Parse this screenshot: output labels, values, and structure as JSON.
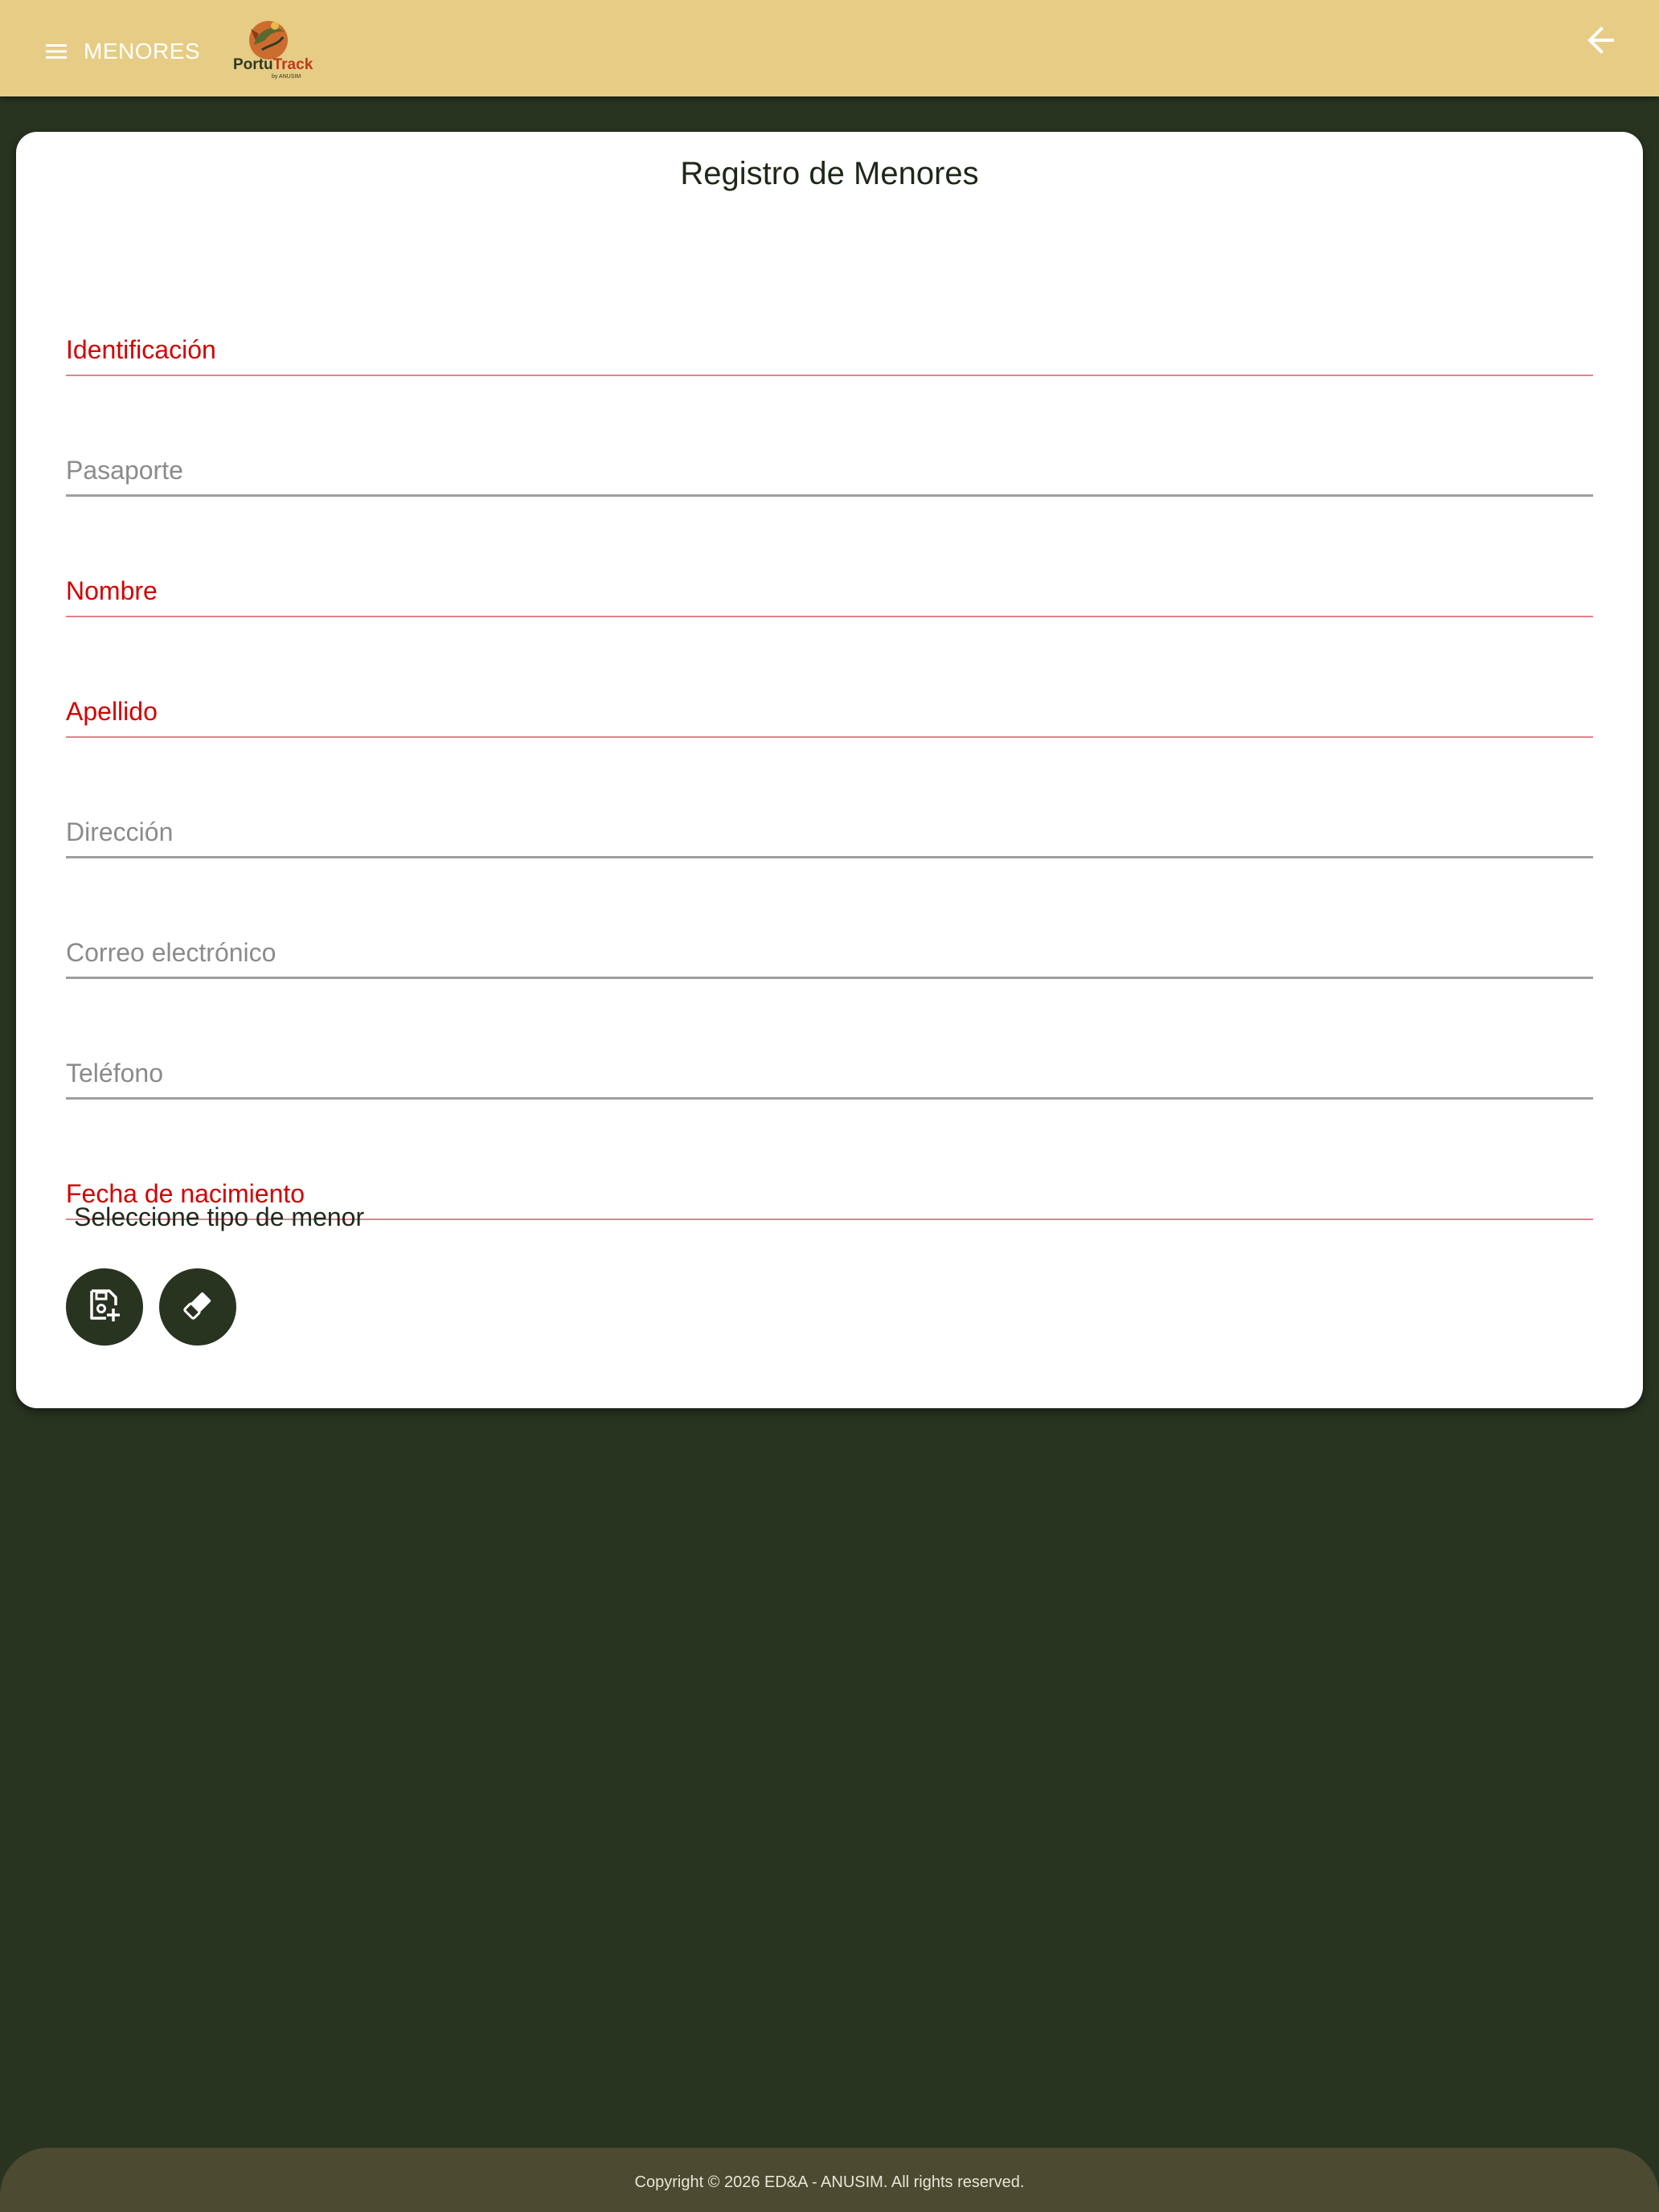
{
  "topbar": {
    "menu_label": "MENORES",
    "menu_icon": "menu-icon",
    "back_icon": "arrow-back-icon",
    "logo": {
      "name": "PortuTrack",
      "part1": "Portu",
      "part2": "Track",
      "sub": "by ANUSIM"
    }
  },
  "form": {
    "title": "Registro de Menores",
    "fields": [
      {
        "label": "Identificación",
        "required": true
      },
      {
        "label": "Pasaporte",
        "required": false
      },
      {
        "label": "Nombre",
        "required": true
      },
      {
        "label": "Apellido",
        "required": true
      },
      {
        "label": "Dirección",
        "required": false
      },
      {
        "label": "Correo electrónico",
        "required": false
      },
      {
        "label": "Teléfono",
        "required": false
      },
      {
        "label": "Fecha de nacimiento",
        "required": true
      }
    ],
    "select_label": "Seleccione tipo de menor",
    "save_icon": "save-add-icon",
    "clear_icon": "eraser-icon"
  },
  "colors": {
    "topbar": "#e6cc84",
    "background": "#283320",
    "required": "#d40000",
    "footer": "#4c4a30"
  },
  "footer": {
    "copyright": "Copyright © 2026 ED&A - ANUSIM. All rights reserved."
  }
}
